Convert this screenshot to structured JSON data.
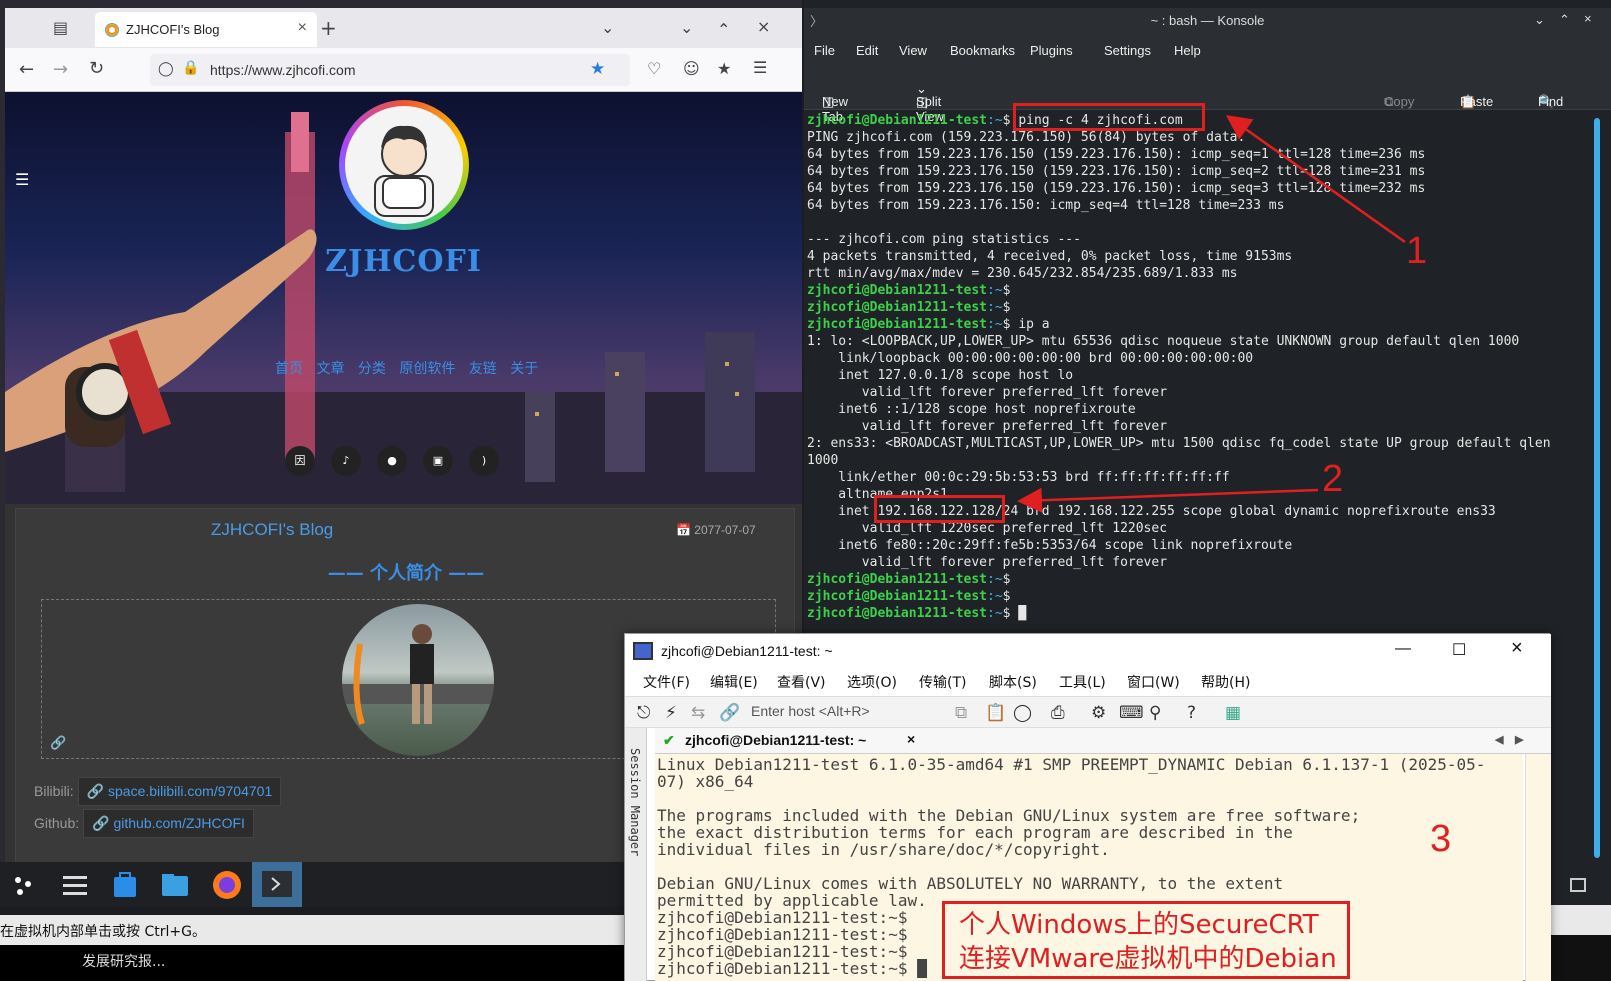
{
  "firefox": {
    "tab_title": "ZJHCOFI's Blog",
    "url": "https://www.zjhcofi.com",
    "blog": {
      "title": "ZJHCOFI",
      "nav": [
        "首页",
        "文章",
        "分类",
        "原创软件",
        "友链",
        "关于"
      ],
      "social": [
        "因車",
        "tiktok",
        "github",
        "bilibili",
        "rss"
      ],
      "card_title": "ZJHCOFI's Blog",
      "card_date": "2077-07-07",
      "section_heading": "—— 个人简介 ——",
      "links": [
        {
          "label": "Bilibili:",
          "value": "space.bilibili.com/9704701"
        },
        {
          "label": "Github:",
          "value": "github.com/ZJHCOFI"
        }
      ]
    }
  },
  "status_bar": {
    "hint": "在虚拟机内部单击或按 Ctrl+G。",
    "item": "发展研究报..."
  },
  "konsole": {
    "title": "~ : bash — Konsole",
    "menu": [
      "File",
      "Edit",
      "View",
      "Bookmarks",
      "Plugins",
      "Settings",
      "Help"
    ],
    "toolbar": {
      "new_tab": "New Tab",
      "split_view": "Split View",
      "copy": "Copy",
      "paste": "Paste",
      "find": "Find"
    },
    "prompt": "zjhcofi@Debian1211-test",
    "lines": [
      {
        "p": true,
        "t": "$ ping -c 4 zjhcofi.com"
      },
      {
        "p": false,
        "t": "PING zjhcofi.com (159.223.176.150) 56(84) bytes of data."
      },
      {
        "p": false,
        "t": "64 bytes from 159.223.176.150 (159.223.176.150): icmp_seq=1 ttl=128 time=236 ms"
      },
      {
        "p": false,
        "t": "64 bytes from 159.223.176.150 (159.223.176.150): icmp_seq=2 ttl=128 time=231 ms"
      },
      {
        "p": false,
        "t": "64 bytes from 159.223.176.150 (159.223.176.150): icmp_seq=3 ttl=128 time=232 ms"
      },
      {
        "p": false,
        "t": "64 bytes from 159.223.176.150: icmp_seq=4 ttl=128 time=233 ms"
      },
      {
        "p": false,
        "t": ""
      },
      {
        "p": false,
        "t": "--- zjhcofi.com ping statistics ---"
      },
      {
        "p": false,
        "t": "4 packets transmitted, 4 received, 0% packet loss, time 9153ms"
      },
      {
        "p": false,
        "t": "rtt min/avg/max/mdev = 230.645/232.854/235.689/1.833 ms"
      },
      {
        "p": true,
        "t": "$"
      },
      {
        "p": true,
        "t": "$"
      },
      {
        "p": true,
        "t": "$ ip a"
      },
      {
        "p": false,
        "t": "1: lo: <LOOPBACK,UP,LOWER_UP> mtu 65536 qdisc noqueue state UNKNOWN group default qlen 1000"
      },
      {
        "p": false,
        "t": "    link/loopback 00:00:00:00:00:00 brd 00:00:00:00:00:00"
      },
      {
        "p": false,
        "t": "    inet 127.0.0.1/8 scope host lo"
      },
      {
        "p": false,
        "t": "       valid_lft forever preferred_lft forever"
      },
      {
        "p": false,
        "t": "    inet6 ::1/128 scope host noprefixroute"
      },
      {
        "p": false,
        "t": "       valid_lft forever preferred_lft forever"
      },
      {
        "p": false,
        "t": "2: ens33: <BROADCAST,MULTICAST,UP,LOWER_UP> mtu 1500 qdisc fq_codel state UP group default qlen"
      },
      {
        "p": false,
        "t": "1000"
      },
      {
        "p": false,
        "t": "    link/ether 00:0c:29:5b:53:53 brd ff:ff:ff:ff:ff:ff"
      },
      {
        "p": false,
        "t": "    altname enp2s1"
      },
      {
        "p": false,
        "t": "    inet 192.168.122.128/24 brd 192.168.122.255 scope global dynamic noprefixroute ens33"
      },
      {
        "p": false,
        "t": "       valid_lft 1220sec preferred_lft 1220sec"
      },
      {
        "p": false,
        "t": "    inet6 fe80::20c:29ff:fe5b:5353/64 scope link noprefixroute"
      },
      {
        "p": false,
        "t": "       valid_lft forever preferred_lft forever"
      },
      {
        "p": true,
        "t": "$"
      },
      {
        "p": true,
        "t": "$"
      },
      {
        "p": true,
        "t": "$ █"
      }
    ]
  },
  "securecrt": {
    "title": "zjhcofi@Debian1211-test: ~",
    "menu": [
      "文件(F)",
      "编辑(E)",
      "查看(V)",
      "选项(O)",
      "传输(T)",
      "脚本(S)",
      "工具(L)",
      "窗口(W)",
      "帮助(H)"
    ],
    "host_placeholder": "Enter host <Alt+R>",
    "session_manager": "Session Manager",
    "tab": "zjhcofi@Debian1211-test: ~",
    "lines": [
      "Linux Debian1211-test 6.1.0-35-amd64 #1 SMP PREEMPT_DYNAMIC Debian 6.1.137-1 (2025-05-",
      "07) x86_64",
      "",
      "The programs included with the Debian GNU/Linux system are free software;",
      "the exact distribution terms for each program are described in the",
      "individual files in /usr/share/doc/*/copyright.",
      "",
      "Debian GNU/Linux comes with ABSOLUTELY NO WARRANTY, to the extent",
      "permitted by applicable law.",
      "zjhcofi@Debian1211-test:~$",
      "zjhcofi@Debian1211-test:~$",
      "zjhcofi@Debian1211-test:~$",
      "zjhcofi@Debian1211-test:~$ █"
    ]
  },
  "annotations": {
    "n1": "1",
    "n2": "2",
    "n3": "3",
    "note_line1": "个人Windows上的SecureCRT",
    "note_line2": "连接VMware虚拟机中的Debian",
    "color": "#e02020"
  }
}
